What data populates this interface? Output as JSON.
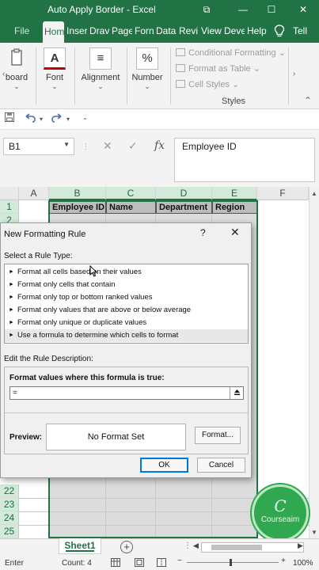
{
  "titlebar": {
    "title": "Auto Apply Border  -  Excel",
    "restore_glyph": "⧉",
    "minimize_glyph": "—",
    "maximize_glyph": "☐",
    "close_glyph": "✕"
  },
  "tabs": [
    {
      "label": "File"
    },
    {
      "label": "Hom"
    },
    {
      "label": "Inser"
    },
    {
      "label": "Drav"
    },
    {
      "label": "Page"
    },
    {
      "label": "Forn"
    },
    {
      "label": "Data"
    },
    {
      "label": "Revi"
    },
    {
      "label": "View"
    },
    {
      "label": "Deve"
    },
    {
      "label": "Help"
    },
    {
      "label": "Tell"
    }
  ],
  "tell_icon": "lightbulb-icon",
  "ribbon": {
    "clipboard_label": "board",
    "font_label": "Font",
    "font_glyph": "A",
    "alignment_label": "Alignment",
    "alignment_glyph": "≡",
    "number_label": "Number",
    "number_glyph": "%",
    "styles": {
      "items": [
        {
          "label": "Conditional Formatting"
        },
        {
          "label": "Format as Table"
        },
        {
          "label": "Cell Styles"
        }
      ],
      "group_label": "Styles"
    }
  },
  "namebox": {
    "value": "B1"
  },
  "formula_bar": {
    "fx": "fx",
    "cancel": "✕",
    "enter": "✓",
    "value": "Employee ID"
  },
  "columns": [
    "A",
    "B",
    "C",
    "D",
    "E",
    "F"
  ],
  "rows": [
    "1",
    "2",
    "22",
    "23",
    "24",
    "25"
  ],
  "headers": {
    "b": "Employee ID",
    "c": "Name",
    "d": "Department",
    "e": "Region"
  },
  "dialog": {
    "title": "New Formatting Rule",
    "help": "?",
    "close": "✕",
    "select_type_label": "Select a Rule Type:",
    "rule_types": [
      {
        "label": "Format all cells based on their values"
      },
      {
        "label": "Format only cells that contain"
      },
      {
        "label": "Format only top or bottom ranked values"
      },
      {
        "label": "Format only values that are above or below average"
      },
      {
        "label": "Format only unique or duplicate values"
      },
      {
        "label": "Use a formula to determine which cells to format"
      }
    ],
    "edit_label": "Edit the Rule Description:",
    "formula_label": "Format values where this formula is true:",
    "formula_value": "=",
    "preview_label": "Preview:",
    "preview_text": "No Format Set",
    "format_button": "Format...",
    "ok_button": "OK",
    "cancel_button": "Cancel"
  },
  "sheet": {
    "tab": "Sheet1",
    "add": "+"
  },
  "status": {
    "mode": "Enter",
    "count": "Count: 4",
    "zoom": "100%"
  },
  "watermark": {
    "text": "Courseaim",
    "logo_letter": "C",
    "logo_text": "Courseaim"
  }
}
